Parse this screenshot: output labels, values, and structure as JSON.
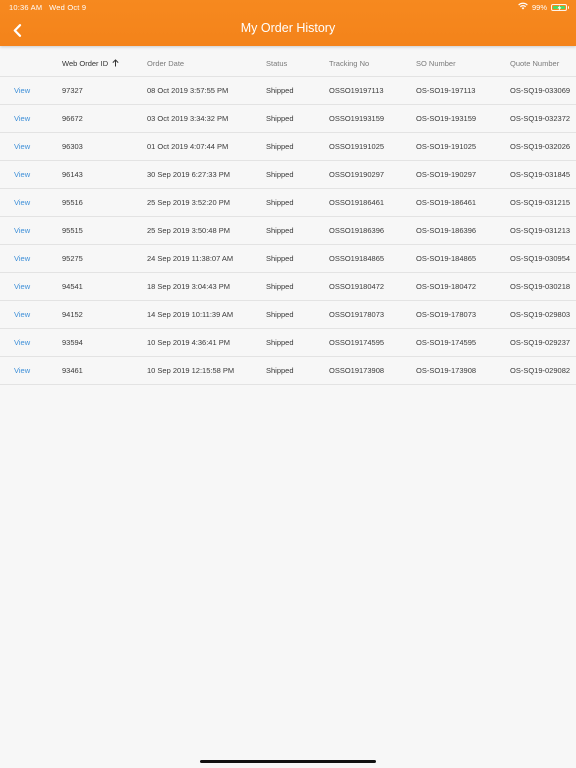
{
  "status_bar": {
    "time": "10:36 AM",
    "date": "Wed Oct 9",
    "battery": "99%",
    "battery_level": 0.99,
    "wifi_icon": "wifi-icon",
    "charging_icon": "charging-icon"
  },
  "header": {
    "title": "My Order History",
    "back_icon": "chevron-left-icon",
    "bar_color": "#f5861d"
  },
  "table": {
    "columns": [
      "",
      "Web Order ID",
      "Order Date",
      "Status",
      "Tracking No",
      "SO Number",
      "Quote Number"
    ],
    "sort_column": "Web Order ID",
    "sort_direction": "ascending",
    "sort_icon": "arrow-up-icon",
    "view_label": "View",
    "rows": [
      {
        "id": "97327",
        "date": "08 Oct 2019 3:57:55 PM",
        "status": "Shipped",
        "tracking": "OSSO19197113",
        "so": "OS-SO19-197113",
        "quote": "OS-SQ19-033069"
      },
      {
        "id": "96672",
        "date": "03 Oct 2019 3:34:32 PM",
        "status": "Shipped",
        "tracking": "OSSO19193159",
        "so": "OS-SO19-193159",
        "quote": "OS-SQ19-032372"
      },
      {
        "id": "96303",
        "date": "01 Oct 2019 4:07:44 PM",
        "status": "Shipped",
        "tracking": "OSSO19191025",
        "so": "OS-SO19-191025",
        "quote": "OS-SQ19-032026"
      },
      {
        "id": "96143",
        "date": "30 Sep 2019 6:27:33 PM",
        "status": "Shipped",
        "tracking": "OSSO19190297",
        "so": "OS-SO19-190297",
        "quote": "OS-SQ19-031845"
      },
      {
        "id": "95516",
        "date": "25 Sep 2019 3:52:20 PM",
        "status": "Shipped",
        "tracking": "OSSO19186461",
        "so": "OS-SO19-186461",
        "quote": "OS-SQ19-031215"
      },
      {
        "id": "95515",
        "date": "25 Sep 2019 3:50:48 PM",
        "status": "Shipped",
        "tracking": "OSSO19186396",
        "so": "OS-SO19-186396",
        "quote": "OS-SQ19-031213"
      },
      {
        "id": "95275",
        "date": "24 Sep 2019 11:38:07 AM",
        "status": "Shipped",
        "tracking": "OSSO19184865",
        "so": "OS-SO19-184865",
        "quote": "OS-SQ19-030954"
      },
      {
        "id": "94541",
        "date": "18 Sep 2019 3:04:43 PM",
        "status": "Shipped",
        "tracking": "OSSO19180472",
        "so": "OS-SO19-180472",
        "quote": "OS-SQ19-030218"
      },
      {
        "id": "94152",
        "date": "14 Sep 2019 10:11:39 AM",
        "status": "Shipped",
        "tracking": "OSSO19178073",
        "so": "OS-SO19-178073",
        "quote": "OS-SQ19-029803"
      },
      {
        "id": "93594",
        "date": "10 Sep 2019 4:36:41 PM",
        "status": "Shipped",
        "tracking": "OSSO19174595",
        "so": "OS-SO19-174595",
        "quote": "OS-SQ19-029237"
      },
      {
        "id": "93461",
        "date": "10 Sep 2019 12:15:58 PM",
        "status": "Shipped",
        "tracking": "OSSO19173908",
        "so": "OS-SO19-173908",
        "quote": "OS-SQ19-029082"
      }
    ]
  },
  "colors": {
    "accent": "#f5861d",
    "link": "#3d8fd8",
    "background": "#f7f7f7"
  }
}
